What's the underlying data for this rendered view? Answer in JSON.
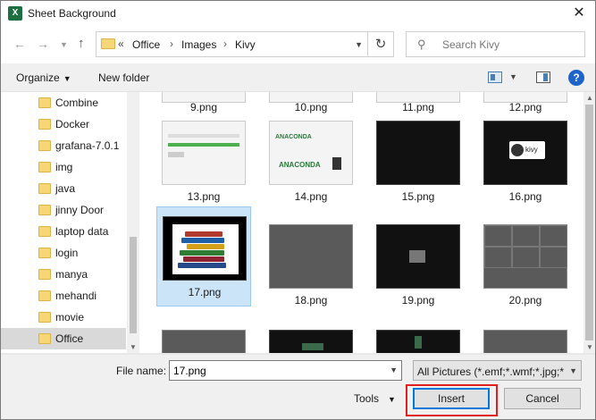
{
  "window": {
    "title": "Sheet Background",
    "app_icon": "excel-icon",
    "close_glyph": "✕"
  },
  "address": {
    "overflow": "«",
    "crumbs": [
      "Office",
      "Images",
      "Kivy"
    ],
    "separator": "›",
    "search_placeholder": "Search Kivy"
  },
  "toolbar": {
    "organize_label": "Organize",
    "new_folder_label": "New folder",
    "help_glyph": "?"
  },
  "nav": {
    "items": [
      {
        "label": "Combine"
      },
      {
        "label": "Docker"
      },
      {
        "label": "grafana-7.0.1"
      },
      {
        "label": "img"
      },
      {
        "label": "java"
      },
      {
        "label": "jinny Door"
      },
      {
        "label": "laptop data"
      },
      {
        "label": "login"
      },
      {
        "label": "manya"
      },
      {
        "label": "mehandi"
      },
      {
        "label": "movie"
      },
      {
        "label": "Office"
      }
    ],
    "selected": "Office"
  },
  "files": {
    "row1": [
      "9.png",
      "10.png",
      "11.png",
      "12.png"
    ],
    "row2": [
      "13.png",
      "14.png",
      "15.png",
      "16.png"
    ],
    "row3": [
      "17.png",
      "18.png",
      "19.png",
      "20.png"
    ],
    "selected": "17.png",
    "anaconda_text": "ANACONDA",
    "kivy_text": "kivy"
  },
  "bottom": {
    "file_name_label": "File name:",
    "file_name_value": "17.png",
    "file_type": "All Pictures (*.emf;*.wmf;*.jpg;*",
    "tools_label": "Tools",
    "insert_label": "Insert",
    "cancel_label": "Cancel"
  },
  "colors": {
    "selection_bg": "#cce4f7",
    "highlight_border": "#e02020",
    "accent": "#0078d7"
  }
}
